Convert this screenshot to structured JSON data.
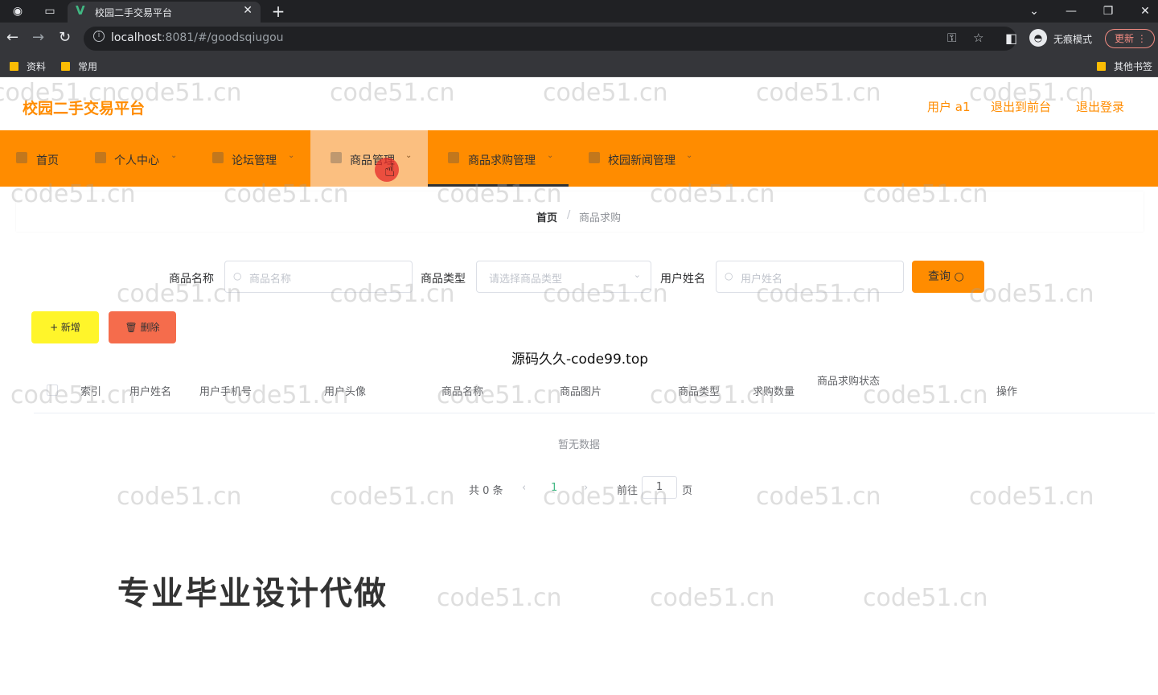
{
  "browser": {
    "tab_title": "校园二手交易平台",
    "url_host": "localhost",
    "url_rest": ":8081/#/goodsqiugou",
    "incognito_label": "无痕模式",
    "update_label": "更新",
    "bookmarks": [
      "资料",
      "常用"
    ],
    "other_bookmarks": "其他书签"
  },
  "header": {
    "title": "校园二手交易平台",
    "user": "用户 a1",
    "front_link": "退出到前台",
    "logout_link": "退出登录"
  },
  "menu": {
    "items": [
      {
        "label": "首页"
      },
      {
        "label": "个人中心"
      },
      {
        "label": "论坛管理"
      },
      {
        "label": "商品管理"
      },
      {
        "label": "商品求购管理"
      },
      {
        "label": "校园新闻管理"
      }
    ]
  },
  "breadcrumb": {
    "home": "首页",
    "sep": "/",
    "current": "商品求购"
  },
  "filters": {
    "name_label": "商品名称",
    "name_placeholder": "商品名称",
    "type_label": "商品类型",
    "type_placeholder": "请选择商品类型",
    "user_label": "用户姓名",
    "user_placeholder": "用户姓名",
    "search_label": "查询"
  },
  "actions": {
    "add_label": "+ 新增",
    "delete_label": "删除"
  },
  "overlay_text": "源码久久-code99.top",
  "table": {
    "columns": [
      "索引",
      "用户姓名",
      "用户手机号",
      "用户头像",
      "商品名称",
      "商品图片",
      "商品类型",
      "求购数量",
      "商品求购状态",
      "操作"
    ],
    "empty_text": "暂无数据"
  },
  "pagination": {
    "total": "共 0 条",
    "prev": "‹",
    "page": "1",
    "next": "›",
    "goto": "前往",
    "goto_value": "1",
    "page_suffix": "页"
  },
  "promo_text": "专业毕业设计代做",
  "watermark": "code51.cn",
  "colors": {
    "accent": "#ff8c00",
    "menu_active": "#fbbf80",
    "add_button": "#fff52a",
    "delete_button": "#f56c4c"
  }
}
